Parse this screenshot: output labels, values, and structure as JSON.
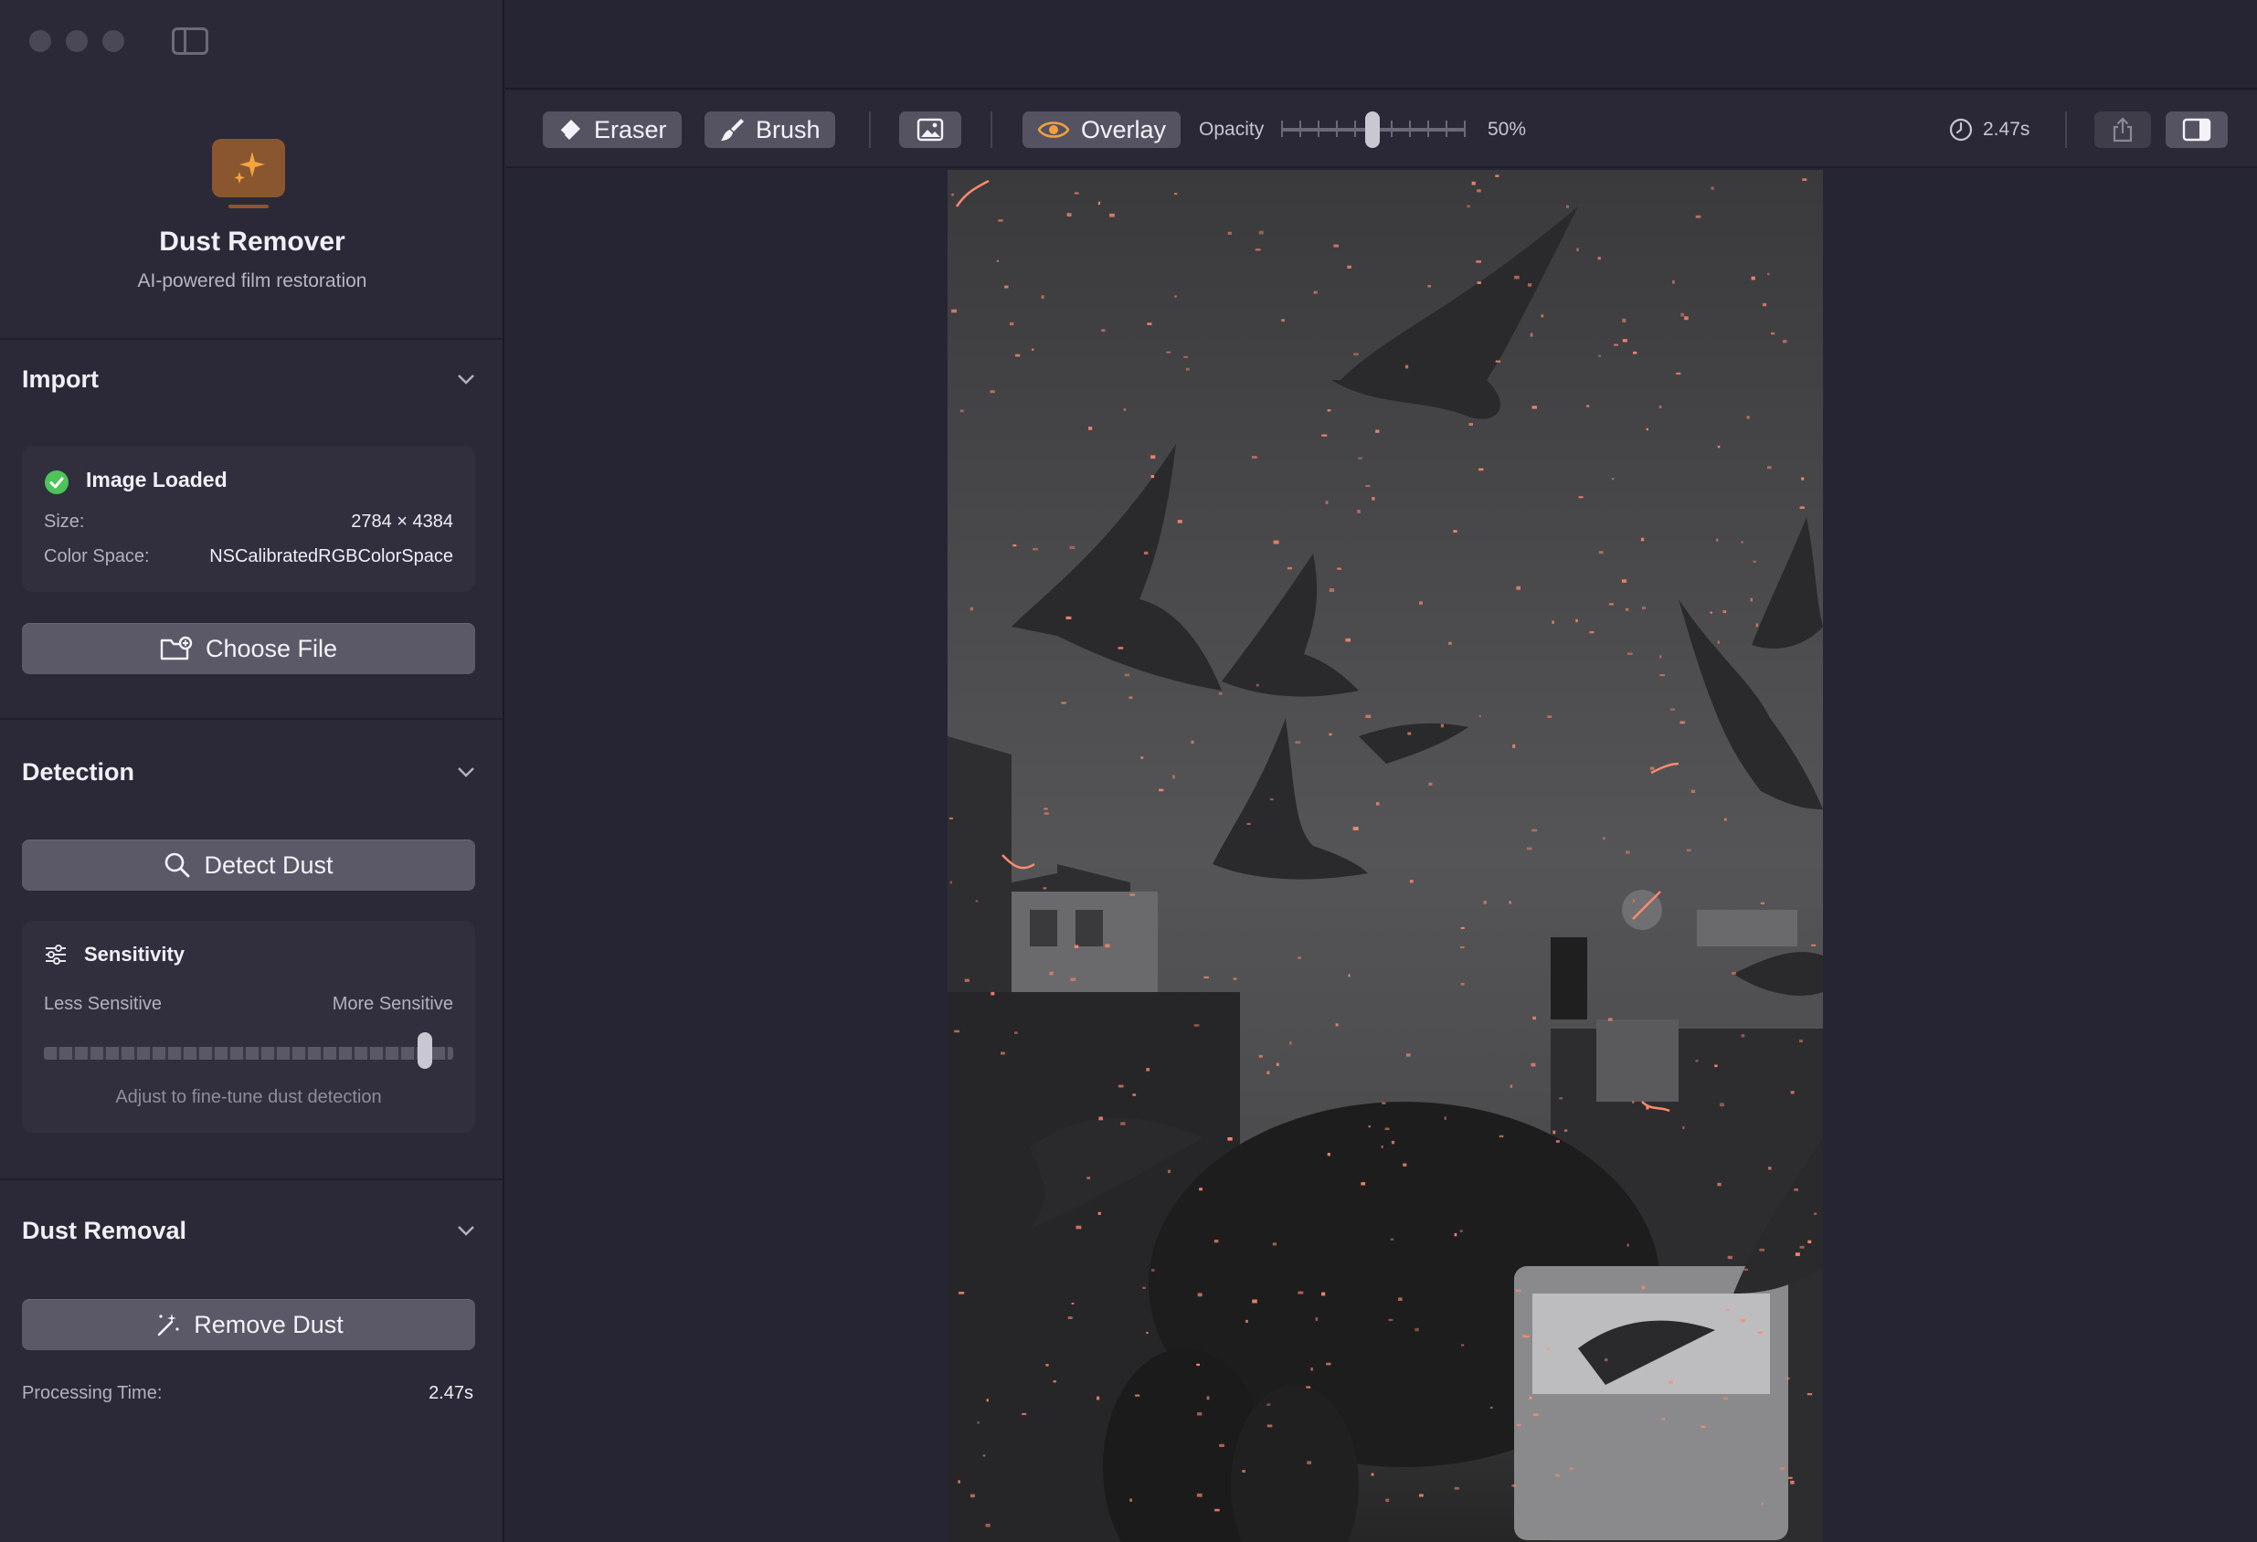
{
  "app": {
    "title": "Dust Remover",
    "subtitle": "AI-powered film restoration",
    "accent_color": "#f0a040"
  },
  "window": {
    "traffic_lights": [
      "close",
      "minimize",
      "zoom"
    ],
    "sidebar_toggle_icon": "sidebar-icon"
  },
  "sections": {
    "import": {
      "title": "Import",
      "status_icon": "checkmark-circle-icon",
      "status_color": "#4cc45a",
      "status": "Image Loaded",
      "size_label": "Size:",
      "size_value": "2784 × 4384",
      "color_space_label": "Color Space:",
      "color_space_value": "NSCalibratedRGBColorSpace",
      "choose_file_label": "Choose File",
      "choose_file_icon": "folder-badge-icon"
    },
    "detection": {
      "title": "Detection",
      "detect_label": "Detect Dust",
      "detect_icon": "magnifier-icon",
      "sensitivity_title": "Sensitivity",
      "sensitivity_icon": "sliders-icon",
      "less_label": "Less Sensitive",
      "more_label": "More Sensitive",
      "sensitivity_value": 0.93,
      "hint": "Adjust to fine-tune dust detection"
    },
    "removal": {
      "title": "Dust Removal",
      "remove_label": "Remove Dust",
      "remove_icon": "magic-wand-icon",
      "processing_label": "Processing Time:",
      "processing_value": "2.47s"
    }
  },
  "toolbar": {
    "eraser_label": "Eraser",
    "eraser_icon": "eraser-icon",
    "brush_label": "Brush",
    "brush_icon": "brush-icon",
    "image_icon": "photo-icon",
    "overlay_label": "Overlay",
    "overlay_icon": "eye-icon",
    "overlay_icon_color": "#f0a040",
    "opacity_label": "Opacity",
    "opacity_value": "50%",
    "opacity_fraction": 0.5,
    "time_icon": "clock-icon",
    "time_value": "2.47s",
    "share_icon": "share-icon",
    "inspector_icon": "inspector-panel-icon"
  },
  "canvas": {
    "overlay_dust_color": "#ff8a70"
  }
}
